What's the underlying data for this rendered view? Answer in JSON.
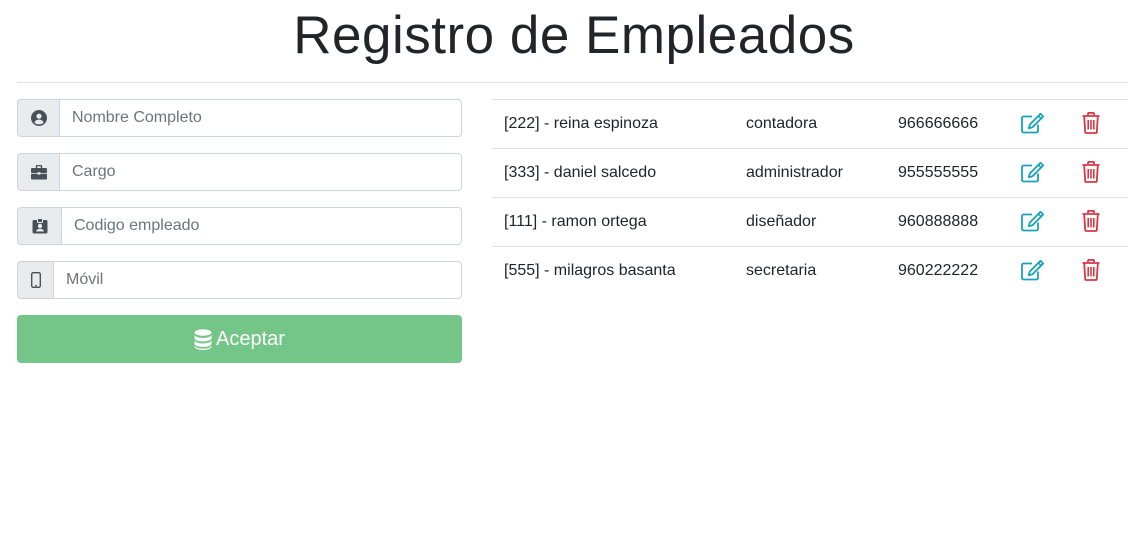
{
  "header": {
    "title": "Registro de Empleados"
  },
  "form": {
    "nombre": {
      "placeholder": "Nombre Completo",
      "icon": "user-circle-icon"
    },
    "cargo": {
      "placeholder": "Cargo",
      "icon": "briefcase-icon"
    },
    "codigo": {
      "placeholder": "Codigo empleado",
      "icon": "id-badge-icon"
    },
    "movil": {
      "placeholder": "Móvil",
      "icon": "mobile-phone-icon"
    },
    "submit": {
      "label": "Aceptar",
      "icon": "database-icon",
      "color": "#73c687"
    }
  },
  "table": {
    "rows": [
      {
        "empleado": "[222] - reina espinoza",
        "cargo": "contadora",
        "telefono": "966666666"
      },
      {
        "empleado": "[333] - daniel salcedo",
        "cargo": "administrador",
        "telefono": "955555555"
      },
      {
        "empleado": "[111] - ramon ortega",
        "cargo": "diseñador",
        "telefono": "960888888"
      },
      {
        "empleado": "[555] - milagros basanta",
        "cargo": "secretaria",
        "telefono": "960222222"
      }
    ],
    "edit_icon": "edit-icon",
    "delete_icon": "trash-icon",
    "edit_color": "#17a2b8",
    "delete_color": "#dc3545"
  }
}
